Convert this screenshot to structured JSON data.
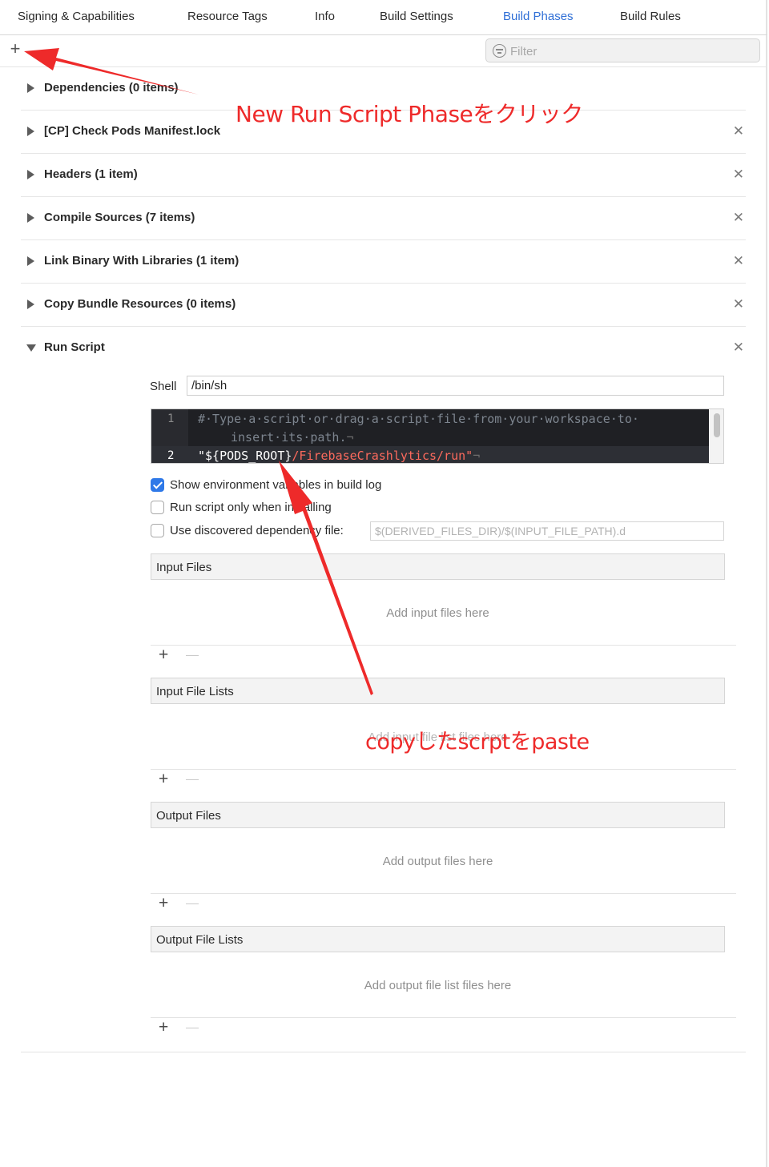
{
  "tabs": [
    {
      "label": "Signing & Capabilities",
      "active": false
    },
    {
      "label": "Resource Tags",
      "active": false
    },
    {
      "label": "Info",
      "active": false
    },
    {
      "label": "Build Settings",
      "active": false
    },
    {
      "label": "Build Phases",
      "active": true
    },
    {
      "label": "Build Rules",
      "active": false
    }
  ],
  "toolbar": {
    "add_icon": "plus-icon",
    "filter_placeholder": "Filter",
    "filter_icon": "filter-icon"
  },
  "phases": [
    {
      "label": "Dependencies (0 items)",
      "expanded": false,
      "closable": false
    },
    {
      "label": "[CP] Check Pods Manifest.lock",
      "expanded": false,
      "closable": true
    },
    {
      "label": "Headers (1 item)",
      "expanded": false,
      "closable": true
    },
    {
      "label": "Compile Sources (7 items)",
      "expanded": false,
      "closable": true
    },
    {
      "label": "Link Binary With Libraries (1 item)",
      "expanded": false,
      "closable": true
    },
    {
      "label": "Copy Bundle Resources (0 items)",
      "expanded": false,
      "closable": true
    },
    {
      "label": "Run Script",
      "expanded": true,
      "closable": true
    }
  ],
  "close_glyph": "✕",
  "run_script": {
    "shell_label": "Shell",
    "shell_value": "/bin/sh",
    "editor": {
      "line_numbers": [
        "1",
        "2"
      ],
      "comment_line_a": "#·Type·a·script·or·drag·a·script·file·from·your·workspace·to·",
      "comment_line_b": "insert·its·path.",
      "code_open": "\"${PODS_ROOT}",
      "code_path": "/FirebaseCrashlytics/run\"",
      "eol_mark": "¬"
    },
    "options": [
      {
        "label": "Show environment variables in build log",
        "checked": true
      },
      {
        "label": "Run script only when installing",
        "checked": false
      },
      {
        "label": "Use discovered dependency file:",
        "checked": false
      }
    ],
    "dependency_placeholder": "$(DERIVED_FILES_DIR)/$(INPUT_FILE_PATH).d",
    "sections": [
      {
        "title": "Input Files",
        "empty_text": "Add input files here"
      },
      {
        "title": "Input File Lists",
        "empty_text": "Add input file list files here"
      },
      {
        "title": "Output Files",
        "empty_text": "Add output files here"
      },
      {
        "title": "Output File Lists",
        "empty_text": "Add output file list files here"
      }
    ],
    "add_glyph": "+",
    "add_icon": "plus-icon",
    "remove_icon": "minus-icon"
  },
  "annotations": {
    "click_note": "New Run Script Phaseをクリック",
    "paste_note": "copyしたscrptをpaste",
    "color": "#ee2a2a"
  }
}
